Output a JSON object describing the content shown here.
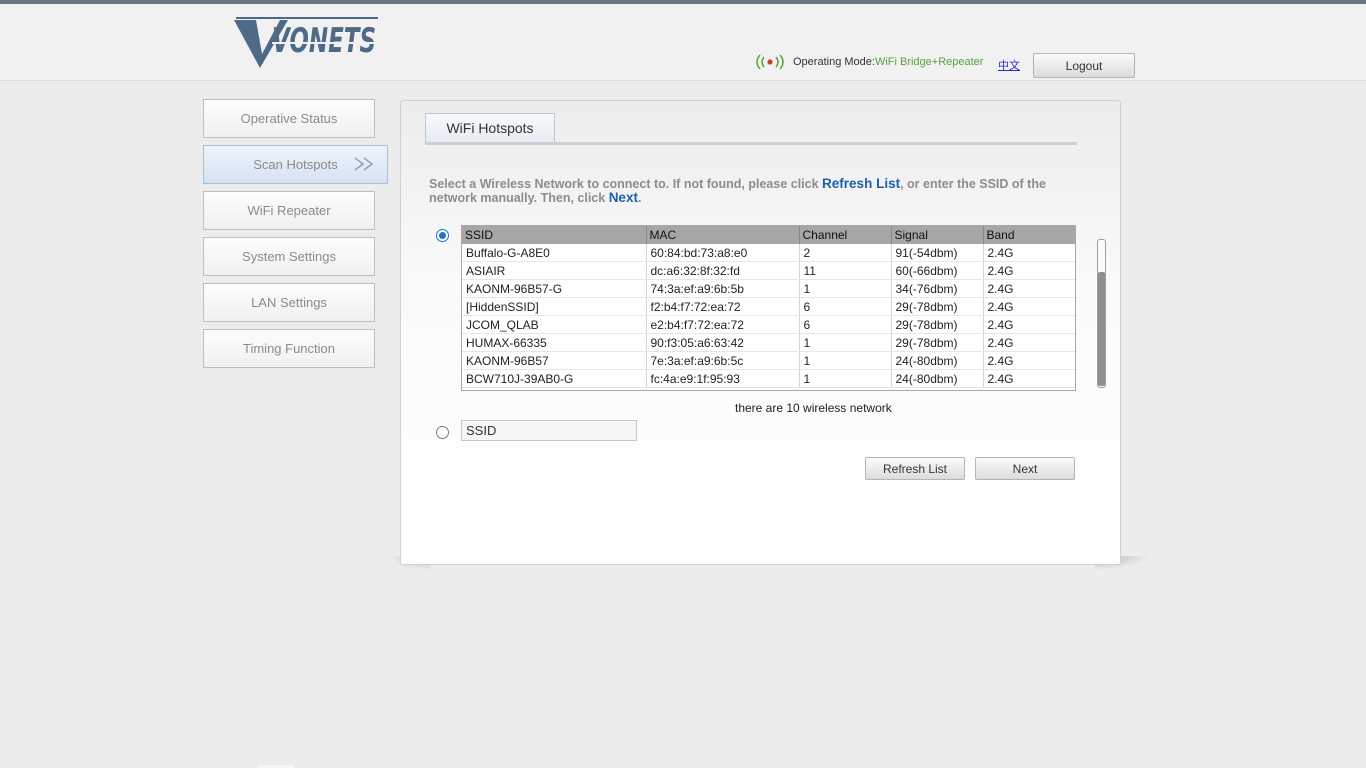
{
  "header": {
    "logo_text": "VONETS",
    "mode_label": "Operating Mode:",
    "mode_value": "WiFi Bridge+Repeater",
    "language_link": "中文",
    "logout_label": "Logout"
  },
  "sidebar": {
    "items": [
      {
        "label": "Operative Status"
      },
      {
        "label": "Scan Hotspots",
        "active": true
      },
      {
        "label": "WiFi Repeater"
      },
      {
        "label": "System Settings"
      },
      {
        "label": "LAN Settings"
      },
      {
        "label": "Timing Function"
      }
    ]
  },
  "main": {
    "tab_label": "WiFi Hotspots",
    "instruction": {
      "part1": "Select a Wireless Network to connect to. If not found, please click ",
      "refresh_link": "Refresh List",
      "part2": ", or enter the SSID of the network manually. Then, click ",
      "next_link": "Next",
      "part3": "."
    },
    "table": {
      "headers": [
        "SSID",
        "MAC",
        "Channel",
        "Signal",
        "Band"
      ],
      "rows": [
        [
          "Buffalo-G-A8E0",
          "60:84:bd:73:a8:e0",
          "2",
          "91(-54dbm)",
          "2.4G"
        ],
        [
          "ASIAIR",
          "dc:a6:32:8f:32:fd",
          "11",
          "60(-66dbm)",
          "2.4G"
        ],
        [
          "KAONM-96B57-G",
          "74:3a:ef:a9:6b:5b",
          "1",
          "34(-76dbm)",
          "2.4G"
        ],
        [
          "[HiddenSSID]",
          "f2:b4:f7:72:ea:72",
          "6",
          "29(-78dbm)",
          "2.4G"
        ],
        [
          "JCOM_QLAB",
          "e2:b4:f7:72:ea:72",
          "6",
          "29(-78dbm)",
          "2.4G"
        ],
        [
          "HUMAX-66335",
          "90:f3:05:a6:63:42",
          "1",
          "29(-78dbm)",
          "2.4G"
        ],
        [
          "KAONM-96B57",
          "7e:3a:ef:a9:6b:5c",
          "1",
          "24(-80dbm)",
          "2.4G"
        ],
        [
          "BCW710J-39AB0-G",
          "fc:4a:e9:1f:95:93",
          "1",
          "24(-80dbm)",
          "2.4G"
        ]
      ]
    },
    "network_count_text": "there are 10 wireless network",
    "ssid_input_value": "SSID",
    "refresh_button": "Refresh List",
    "next_button": "Next"
  }
}
